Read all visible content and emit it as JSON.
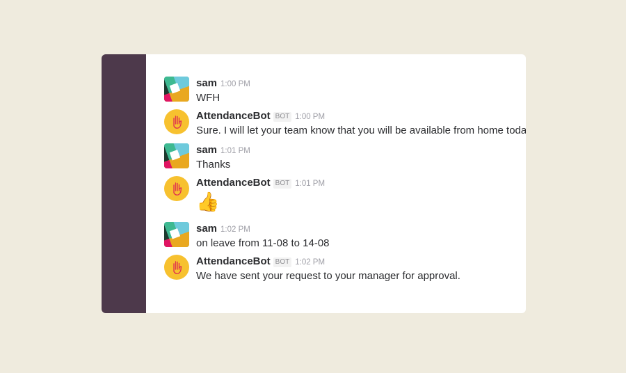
{
  "colors": {
    "background": "#efebde",
    "sidebar": "#4d394b",
    "bot_avatar": "#f7c12f"
  },
  "messages": [
    {
      "author": "sam",
      "badge": "",
      "time": "1:00 PM",
      "text": "WFH",
      "avatar_icon": "slack-logo-icon"
    },
    {
      "author": "AttendanceBot",
      "badge": "BOT",
      "time": "1:00 PM",
      "text": "Sure. I will let your team know that you will be available from home today",
      "avatar_icon": "raised-hand-icon"
    },
    {
      "author": "sam",
      "badge": "",
      "time": "1:01 PM",
      "text": "Thanks",
      "avatar_icon": "slack-logo-icon"
    },
    {
      "author": "AttendanceBot",
      "badge": "BOT",
      "time": "1:01 PM",
      "text": "👍",
      "avatar_icon": "raised-hand-icon"
    },
    {
      "author": "sam",
      "badge": "",
      "time": "1:02 PM",
      "text": "on leave from 11-08 to 14-08",
      "avatar_icon": "slack-logo-icon"
    },
    {
      "author": "AttendanceBot",
      "badge": "BOT",
      "time": "1:02 PM",
      "text": "We have sent your request to your manager for approval.",
      "avatar_icon": "raised-hand-icon"
    }
  ]
}
